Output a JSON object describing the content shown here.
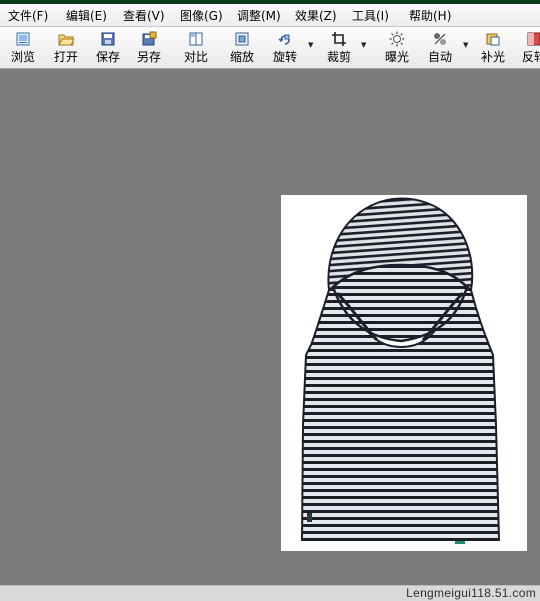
{
  "menubar": {
    "items": [
      {
        "label": "文件(F)"
      },
      {
        "label": "编辑(E)"
      },
      {
        "label": "查看(V)"
      },
      {
        "label": "图像(G)"
      },
      {
        "label": "调整(M)"
      },
      {
        "label": "效果(Z)"
      },
      {
        "label": "工具(I)"
      },
      {
        "label": "帮助(H)"
      }
    ]
  },
  "toolbar": {
    "buttons": [
      {
        "label": "浏览",
        "icon": "browse-icon"
      },
      {
        "label": "打开",
        "icon": "open-folder-icon"
      },
      {
        "label": "保存",
        "icon": "save-icon"
      },
      {
        "label": "另存",
        "icon": "save-as-icon"
      },
      {
        "label": "对比",
        "icon": "compare-icon"
      },
      {
        "label": "缩放",
        "icon": "zoom-icon"
      },
      {
        "label": "旋转",
        "icon": "rotate-icon"
      },
      {
        "label": "裁剪",
        "icon": "crop-icon"
      },
      {
        "label": "曝光",
        "icon": "exposure-icon"
      },
      {
        "label": "自动",
        "icon": "auto-icon"
      },
      {
        "label": "补光",
        "icon": "fill-light-icon"
      },
      {
        "label": "反转",
        "icon": "invert-icon"
      }
    ]
  },
  "status": {
    "watermark": "Lengmeigui118.51.com"
  },
  "colors": {
    "canvas": "#7b7b7b",
    "toolbar": "#efefef",
    "stripe_dark": "#1b1f29",
    "stripe_light": "#e6e7ea"
  }
}
